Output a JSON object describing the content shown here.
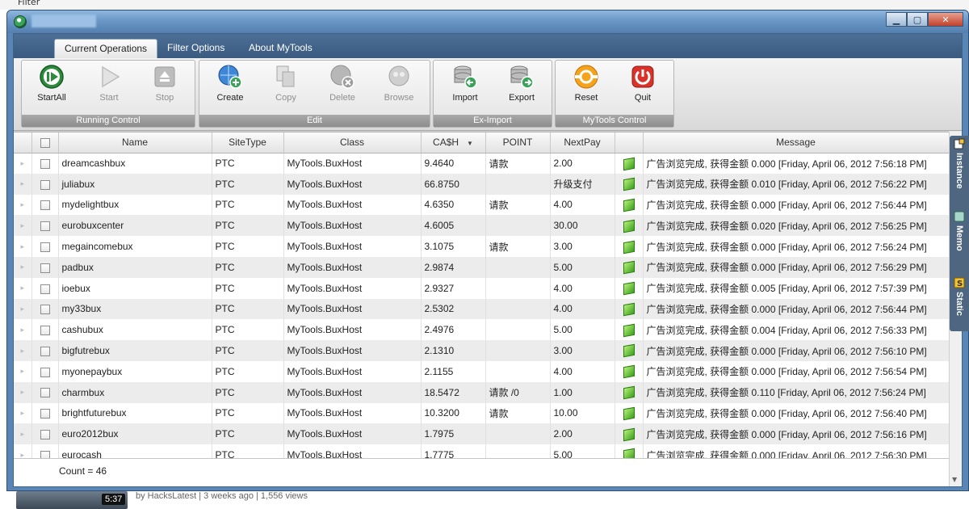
{
  "desktop": {
    "menu_label": "Filter",
    "video": {
      "duration": "5:37",
      "meta": "by HacksLatest | 3 weeks ago | 1,556 views"
    }
  },
  "window": {
    "controls": [
      "minimize",
      "maximize",
      "close"
    ]
  },
  "tabs": [
    {
      "label": "Current Operations",
      "active": true
    },
    {
      "label": "Filter Options",
      "active": false
    },
    {
      "label": "About MyTools",
      "active": false
    }
  ],
  "ribbon": {
    "groups": [
      {
        "label": "Running Control",
        "buttons": [
          {
            "label": "StartAll",
            "icon": "play-circle-icon",
            "enabled": true
          },
          {
            "label": "Start",
            "icon": "play-triangle-icon",
            "enabled": false
          },
          {
            "label": "Stop",
            "icon": "stop-icon",
            "enabled": false
          }
        ]
      },
      {
        "label": "Edit",
        "buttons": [
          {
            "label": "Create",
            "icon": "globe-add-icon",
            "enabled": true
          },
          {
            "label": "Copy",
            "icon": "copy-icon",
            "enabled": false
          },
          {
            "label": "Delete",
            "icon": "globe-delete-icon",
            "enabled": false
          },
          {
            "label": "Browse",
            "icon": "globe-browse-icon",
            "enabled": false
          }
        ]
      },
      {
        "label": "Ex-Import",
        "buttons": [
          {
            "label": "Import",
            "icon": "database-import-icon",
            "enabled": true
          },
          {
            "label": "Export",
            "icon": "database-export-icon",
            "enabled": true
          }
        ]
      },
      {
        "label": "MyTools Control",
        "buttons": [
          {
            "label": "Reset",
            "icon": "reset-icon",
            "enabled": true
          },
          {
            "label": "Quit",
            "icon": "power-icon",
            "enabled": true
          }
        ]
      }
    ]
  },
  "grid": {
    "columns": [
      "Name",
      "SiteType",
      "Class",
      "CA$H",
      "POINT",
      "NextPay",
      "",
      "Message"
    ],
    "sorted_column": "CA$H",
    "rows": [
      {
        "name": "dreamcashbux",
        "site_type": "PTC",
        "class": "MyTools.BuxHost",
        "cash": "9.4640",
        "point": "请款",
        "next_pay": "2.00",
        "message": "广告浏览完成, 获得金额 0.000 [Friday, April 06, 2012 7:56:18 PM]"
      },
      {
        "name": "juliabux",
        "site_type": "PTC",
        "class": "MyTools.BuxHost",
        "cash": "66.8750",
        "point": "",
        "next_pay": "升级支付",
        "message": "广告浏览完成, 获得金额 0.010 [Friday, April 06, 2012 7:56:22 PM]"
      },
      {
        "name": "mydelightbux",
        "site_type": "PTC",
        "class": "MyTools.BuxHost",
        "cash": "4.6350",
        "point": "请款",
        "next_pay": "4.00",
        "message": "广告浏览完成, 获得金额 0.000 [Friday, April 06, 2012 7:56:44 PM]"
      },
      {
        "name": "eurobuxcenter",
        "site_type": "PTC",
        "class": "MyTools.BuxHost",
        "cash": "4.6005",
        "point": "",
        "next_pay": "30.00",
        "message": "广告浏览完成, 获得金额 0.020 [Friday, April 06, 2012 7:56:25 PM]"
      },
      {
        "name": "megaincomebux",
        "site_type": "PTC",
        "class": "MyTools.BuxHost",
        "cash": "3.1075",
        "point": "请款",
        "next_pay": "3.00",
        "message": "广告浏览完成, 获得金额 0.000 [Friday, April 06, 2012 7:56:24 PM]"
      },
      {
        "name": "padbux",
        "site_type": "PTC",
        "class": "MyTools.BuxHost",
        "cash": "2.9874",
        "point": "",
        "next_pay": "5.00",
        "message": "广告浏览完成, 获得金额 0.000 [Friday, April 06, 2012 7:56:29 PM]"
      },
      {
        "name": "ioebux",
        "site_type": "PTC",
        "class": "MyTools.BuxHost",
        "cash": "2.9327",
        "point": "",
        "next_pay": "4.00",
        "message": "广告浏览完成, 获得金额 0.005 [Friday, April 06, 2012 7:57:39 PM]"
      },
      {
        "name": "my33bux",
        "site_type": "PTC",
        "class": "MyTools.BuxHost",
        "cash": "2.5302",
        "point": "",
        "next_pay": "4.00",
        "message": "广告浏览完成, 获得金额 0.000 [Friday, April 06, 2012 7:56:44 PM]"
      },
      {
        "name": "cashubux",
        "site_type": "PTC",
        "class": "MyTools.BuxHost",
        "cash": "2.4976",
        "point": "",
        "next_pay": "5.00",
        "message": "广告浏览完成, 获得金额 0.004 [Friday, April 06, 2012 7:56:33 PM]"
      },
      {
        "name": "bigfutrebux",
        "site_type": "PTC",
        "class": "MyTools.BuxHost",
        "cash": "2.1310",
        "point": "",
        "next_pay": "3.00",
        "message": "广告浏览完成, 获得金额 0.000 [Friday, April 06, 2012 7:56:10 PM]"
      },
      {
        "name": "myonepaybux",
        "site_type": "PTC",
        "class": "MyTools.BuxHost",
        "cash": "2.1155",
        "point": "",
        "next_pay": "4.00",
        "message": "广告浏览完成, 获得金额 0.000 [Friday, April 06, 2012 7:56:54 PM]"
      },
      {
        "name": "charmbux",
        "site_type": "PTC",
        "class": "MyTools.BuxHost",
        "cash": "18.5472",
        "point": "请款     /0",
        "next_pay": "1.00",
        "message": "广告浏览完成, 获得金额 0.110 [Friday, April 06, 2012 7:56:24 PM]"
      },
      {
        "name": "brightfuturebux",
        "site_type": "PTC",
        "class": "MyTools.BuxHost",
        "cash": "10.3200",
        "point": "请款",
        "next_pay": "10.00",
        "message": "广告浏览完成, 获得金额 0.000 [Friday, April 06, 2012 7:56:40 PM]"
      },
      {
        "name": "euro2012bux",
        "site_type": "PTC",
        "class": "MyTools.BuxHost",
        "cash": "1.7975",
        "point": "",
        "next_pay": "2.00",
        "message": "广告浏览完成, 获得金额 0.000 [Friday, April 06, 2012 7:56:16 PM]"
      },
      {
        "name": "eurocash",
        "site_type": "PTC",
        "class": "MyTools.BuxHost",
        "cash": "1.7775",
        "point": "",
        "next_pay": "5.00",
        "message": "广告浏览完成, 获得金额 0.000 [Friday, April 06, 2012 7:56:30 PM]"
      }
    ]
  },
  "footer": {
    "count": "Count = 46"
  },
  "side_dock": [
    {
      "label": "Instance",
      "icon": "instance-icon"
    },
    {
      "label": "Memo",
      "icon": "memo-icon"
    },
    {
      "label": "Static",
      "icon": "static-icon"
    }
  ],
  "colors": {
    "accent": "#3a5a80",
    "title_bar": "#6a97c6",
    "status_green": "#3aa01d",
    "quit_red": "#d9322a",
    "reset_orange": "#f5a31a"
  }
}
